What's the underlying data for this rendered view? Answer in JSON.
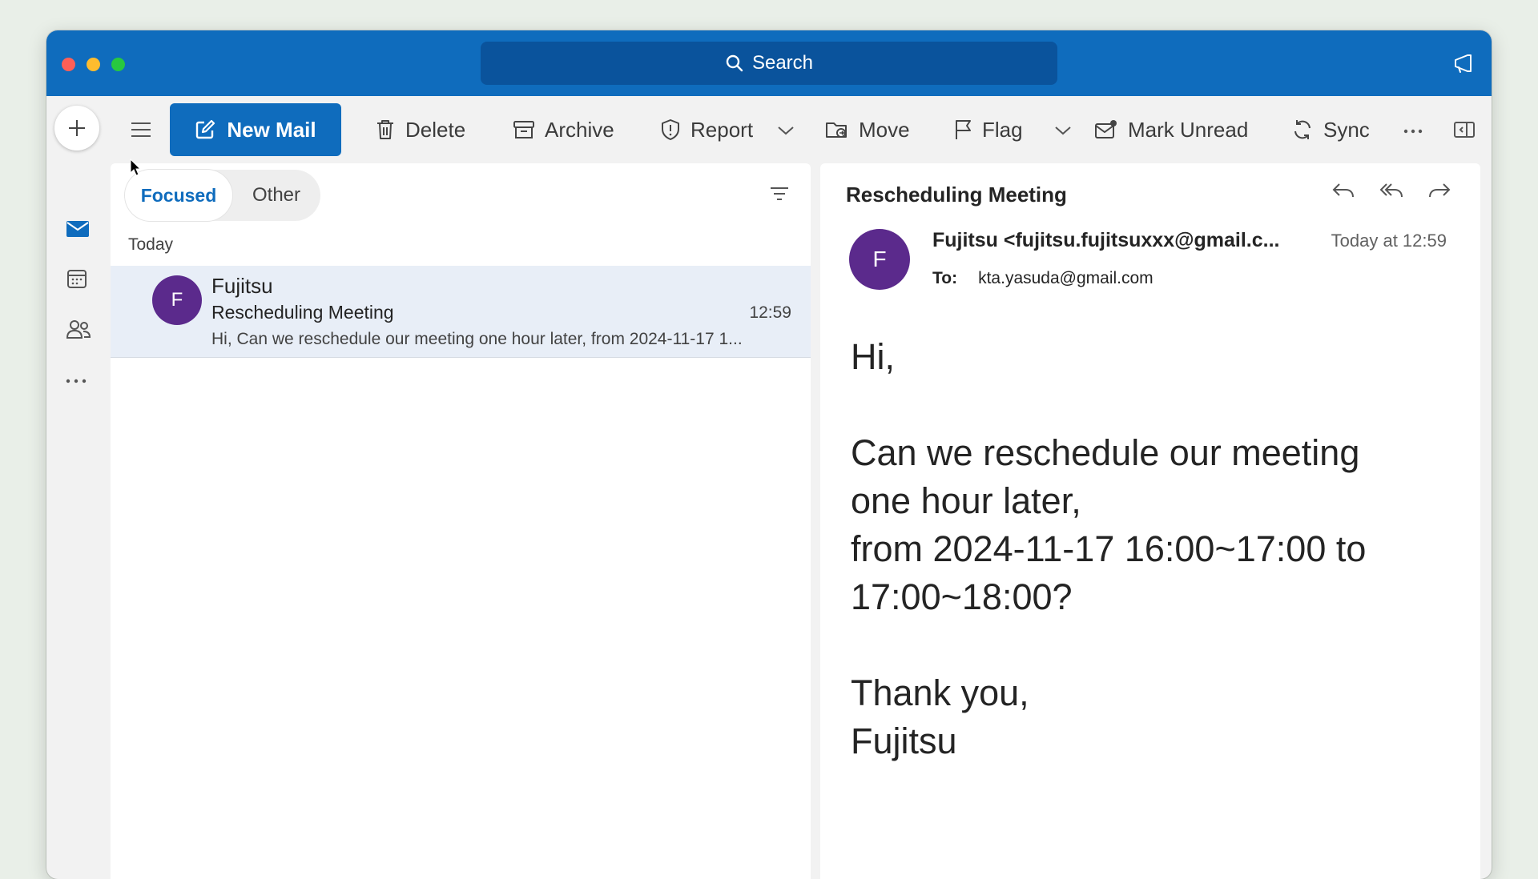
{
  "search": {
    "label": "Search"
  },
  "toolbar": {
    "new_mail": "New Mail",
    "delete": "Delete",
    "archive": "Archive",
    "report": "Report",
    "move": "Move",
    "flag": "Flag",
    "mark_unread": "Mark Unread",
    "sync": "Sync"
  },
  "list": {
    "tabs": {
      "focused": "Focused",
      "other": "Other"
    },
    "group_header": "Today",
    "messages": [
      {
        "avatar": "F",
        "sender": "Fujitsu",
        "subject": "Rescheduling Meeting",
        "time": "12:59",
        "preview": "Hi, Can we reschedule our meeting one hour later, from 2024-11-17 1..."
      }
    ]
  },
  "reading": {
    "subject": "Rescheduling Meeting",
    "avatar": "F",
    "from": "Fujitsu <fujitsu.fujitsuxxx@gmail.c...",
    "date": "Today at 12:59",
    "to_label": "To:",
    "to": "kta.yasuda@gmail.com",
    "body": "Hi,\n\nCan we reschedule our meeting one hour later,\nfrom 2024-11-17 16:00~17:00 to 17:00~18:00?\n\nThank you,\nFujitsu"
  },
  "colors": {
    "accent": "#0f6cbd",
    "avatar": "#5b2a8c",
    "selected_row": "#e8eef7"
  },
  "icons": [
    "search-icon",
    "feedback-icon",
    "compose-icon",
    "hamburger-icon",
    "new-mail-icon",
    "delete-icon",
    "archive-icon",
    "report-icon",
    "move-icon",
    "flag-icon",
    "mark-unread-icon",
    "sync-icon",
    "more-icon",
    "reading-pane-icon",
    "mail-icon",
    "calendar-icon",
    "people-icon",
    "more-apps-icon",
    "filter-icon",
    "reply-icon",
    "reply-all-icon",
    "forward-icon"
  ]
}
